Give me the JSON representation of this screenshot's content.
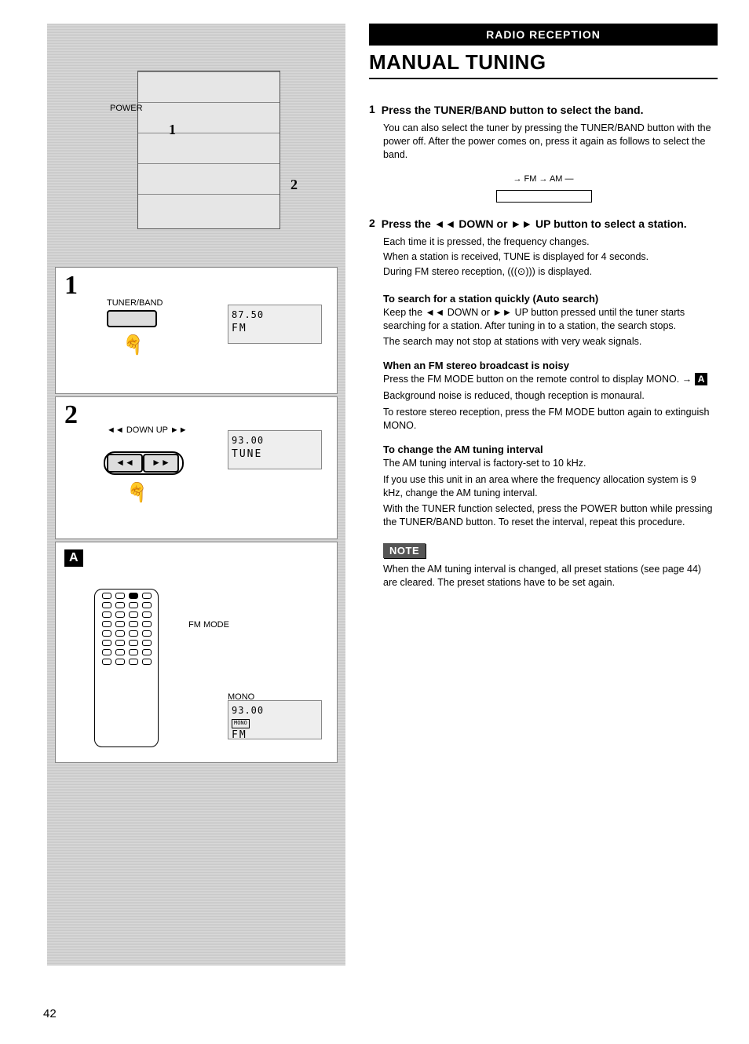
{
  "section_header": "RADIO RECEPTION",
  "main_title": "MANUAL TUNING",
  "page_number": "42",
  "left": {
    "power_label": "POWER",
    "callout_1": "1",
    "callout_2": "2",
    "block1_num": "1",
    "block1_label": "TUNER/BAND",
    "block1_lcd_freq": "87.50",
    "block1_lcd_band": "FM",
    "block2_num": "2",
    "block2_label": "◄◄ DOWN   UP ►►",
    "block2_btn_down": "◄◄",
    "block2_btn_up": "►►",
    "block2_lcd_freq": "93.00",
    "block2_lcd_text": "TUNE",
    "block3_tag": "A",
    "block3_fm_mode": "FM MODE",
    "block3_mono": "MONO",
    "block3_lcd_freq": "93.00",
    "block3_lcd_mono": "MONO",
    "block3_lcd_band": "FM"
  },
  "steps": {
    "s1": {
      "num": "1",
      "head": "Press the TUNER/BAND button to select the band.",
      "body": "You can also select the tuner by pressing the TUNER/BAND button with the power off. After the power comes on, press it again as follows to select the band.",
      "loop": "→ FM → AM ―"
    },
    "s2": {
      "num": "2",
      "head": "Press the ◄◄ DOWN or ►► UP button to select a station.",
      "body1": "Each time it is pressed, the frequency changes.",
      "body2": "When a station is received, TUNE is displayed for 4 seconds.",
      "body3": "During FM stereo reception, (((⊙))) is displayed."
    }
  },
  "sub_autosearch": {
    "head": "To search for a station quickly (Auto search)",
    "p1": "Keep the ◄◄ DOWN or ►► UP button pressed until the tuner starts searching for a station. After tuning in to a station, the search stops.",
    "p2": "The search may not stop at stations with very weak signals."
  },
  "sub_fm": {
    "head": "When an FM stereo broadcast is noisy",
    "p1a": "Press the FM MODE button on the remote control to display MONO. → ",
    "p1b": "A",
    "p2": "Background noise is reduced, though reception is monaural.",
    "p3": "To restore stereo reception, press the FM MODE button again to extinguish MONO."
  },
  "sub_am": {
    "head": "To change the AM tuning interval",
    "p1": "The AM tuning interval is factory-set to 10 kHz.",
    "p2": "If you use this unit in an area where the frequency allocation system is 9 kHz, change the AM tuning interval.",
    "p3": "With the TUNER function selected, press the POWER button while pressing the TUNER/BAND button. To reset the interval, repeat this procedure."
  },
  "note": {
    "label": "NOTE",
    "text": "When the AM tuning interval is changed, all preset stations (see page 44) are cleared. The preset stations have to be set again."
  }
}
